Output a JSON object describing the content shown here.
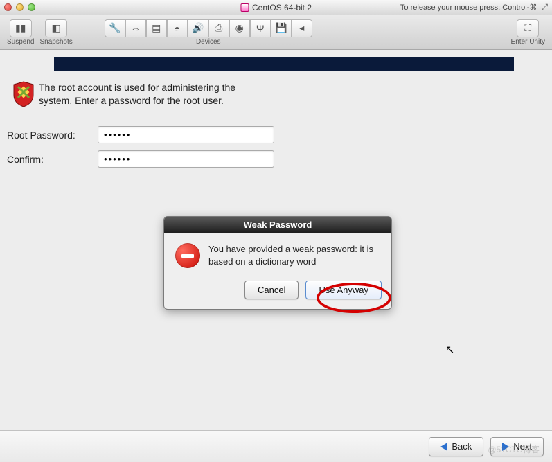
{
  "window": {
    "title": "CentOS 64-bit 2",
    "release_hint": "To release your mouse press: Control-⌘"
  },
  "toolbar": {
    "suspend": "Suspend",
    "snapshots": "Snapshots",
    "devices": "Devices",
    "enter_unity": "Enter Unity",
    "icons": {
      "suspend": "pause-icon",
      "snapshots": "camera-icon",
      "enter_unity": "fullscreen-icon"
    }
  },
  "installer": {
    "intro": "The root account is used for administering the system.  Enter a password for the root user.",
    "labels": {
      "root_password": "Root Password:",
      "confirm": "Confirm:"
    },
    "values": {
      "root_password": "••••••",
      "confirm": "••••••"
    }
  },
  "dialog": {
    "title": "Weak Password",
    "message": "You have provided a weak password: it is based on a dictionary word",
    "cancel": "Cancel",
    "use_anyway": "Use Anyway"
  },
  "footer": {
    "back": "Back",
    "next": "Next"
  },
  "watermark": "@51CTO博客"
}
